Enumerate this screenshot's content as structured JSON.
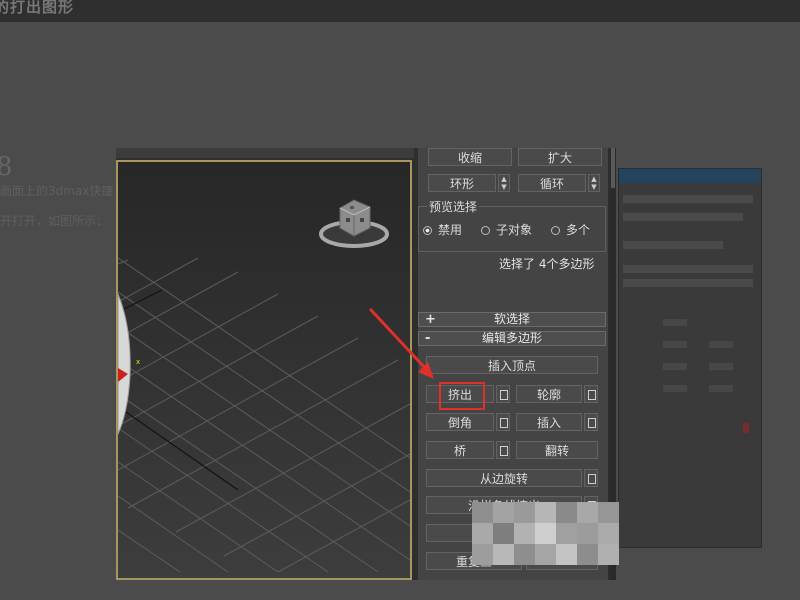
{
  "page_header": {
    "title": "的打出图形"
  },
  "article": {
    "heading_fragment": "8",
    "line1_fragment": "画面上的3dmax快捷",
    "line2_fragment": "开打开，如图所示："
  },
  "command_panel": {
    "shrink_label": "收缩",
    "grow_label": "扩大",
    "ring_label": "环形",
    "loop_label": "循环",
    "preview_selection": {
      "title": "预览选择",
      "options": [
        {
          "label": "禁用",
          "selected": true
        },
        {
          "label": "子对象",
          "selected": false
        },
        {
          "label": "多个",
          "selected": false
        }
      ]
    },
    "selection_status": "选择了 4个多边形",
    "soft_selection_rollout": {
      "sign": "+",
      "label": "软选择"
    },
    "edit_polygons_rollout": {
      "sign": "-",
      "label": "编辑多边形"
    },
    "buttons": {
      "insert_vertex": "插入顶点",
      "extrude": "挤出",
      "outline": "轮廓",
      "bevel": "倒角",
      "inset": "插入",
      "bridge": "桥",
      "flip": "翻转",
      "hinge_from_edge": "从边旋转",
      "extrude_along_spline": "沿样条线挤出",
      "retriangulate": "重复三"
    }
  },
  "annotation": {
    "color": "#e0302c"
  }
}
